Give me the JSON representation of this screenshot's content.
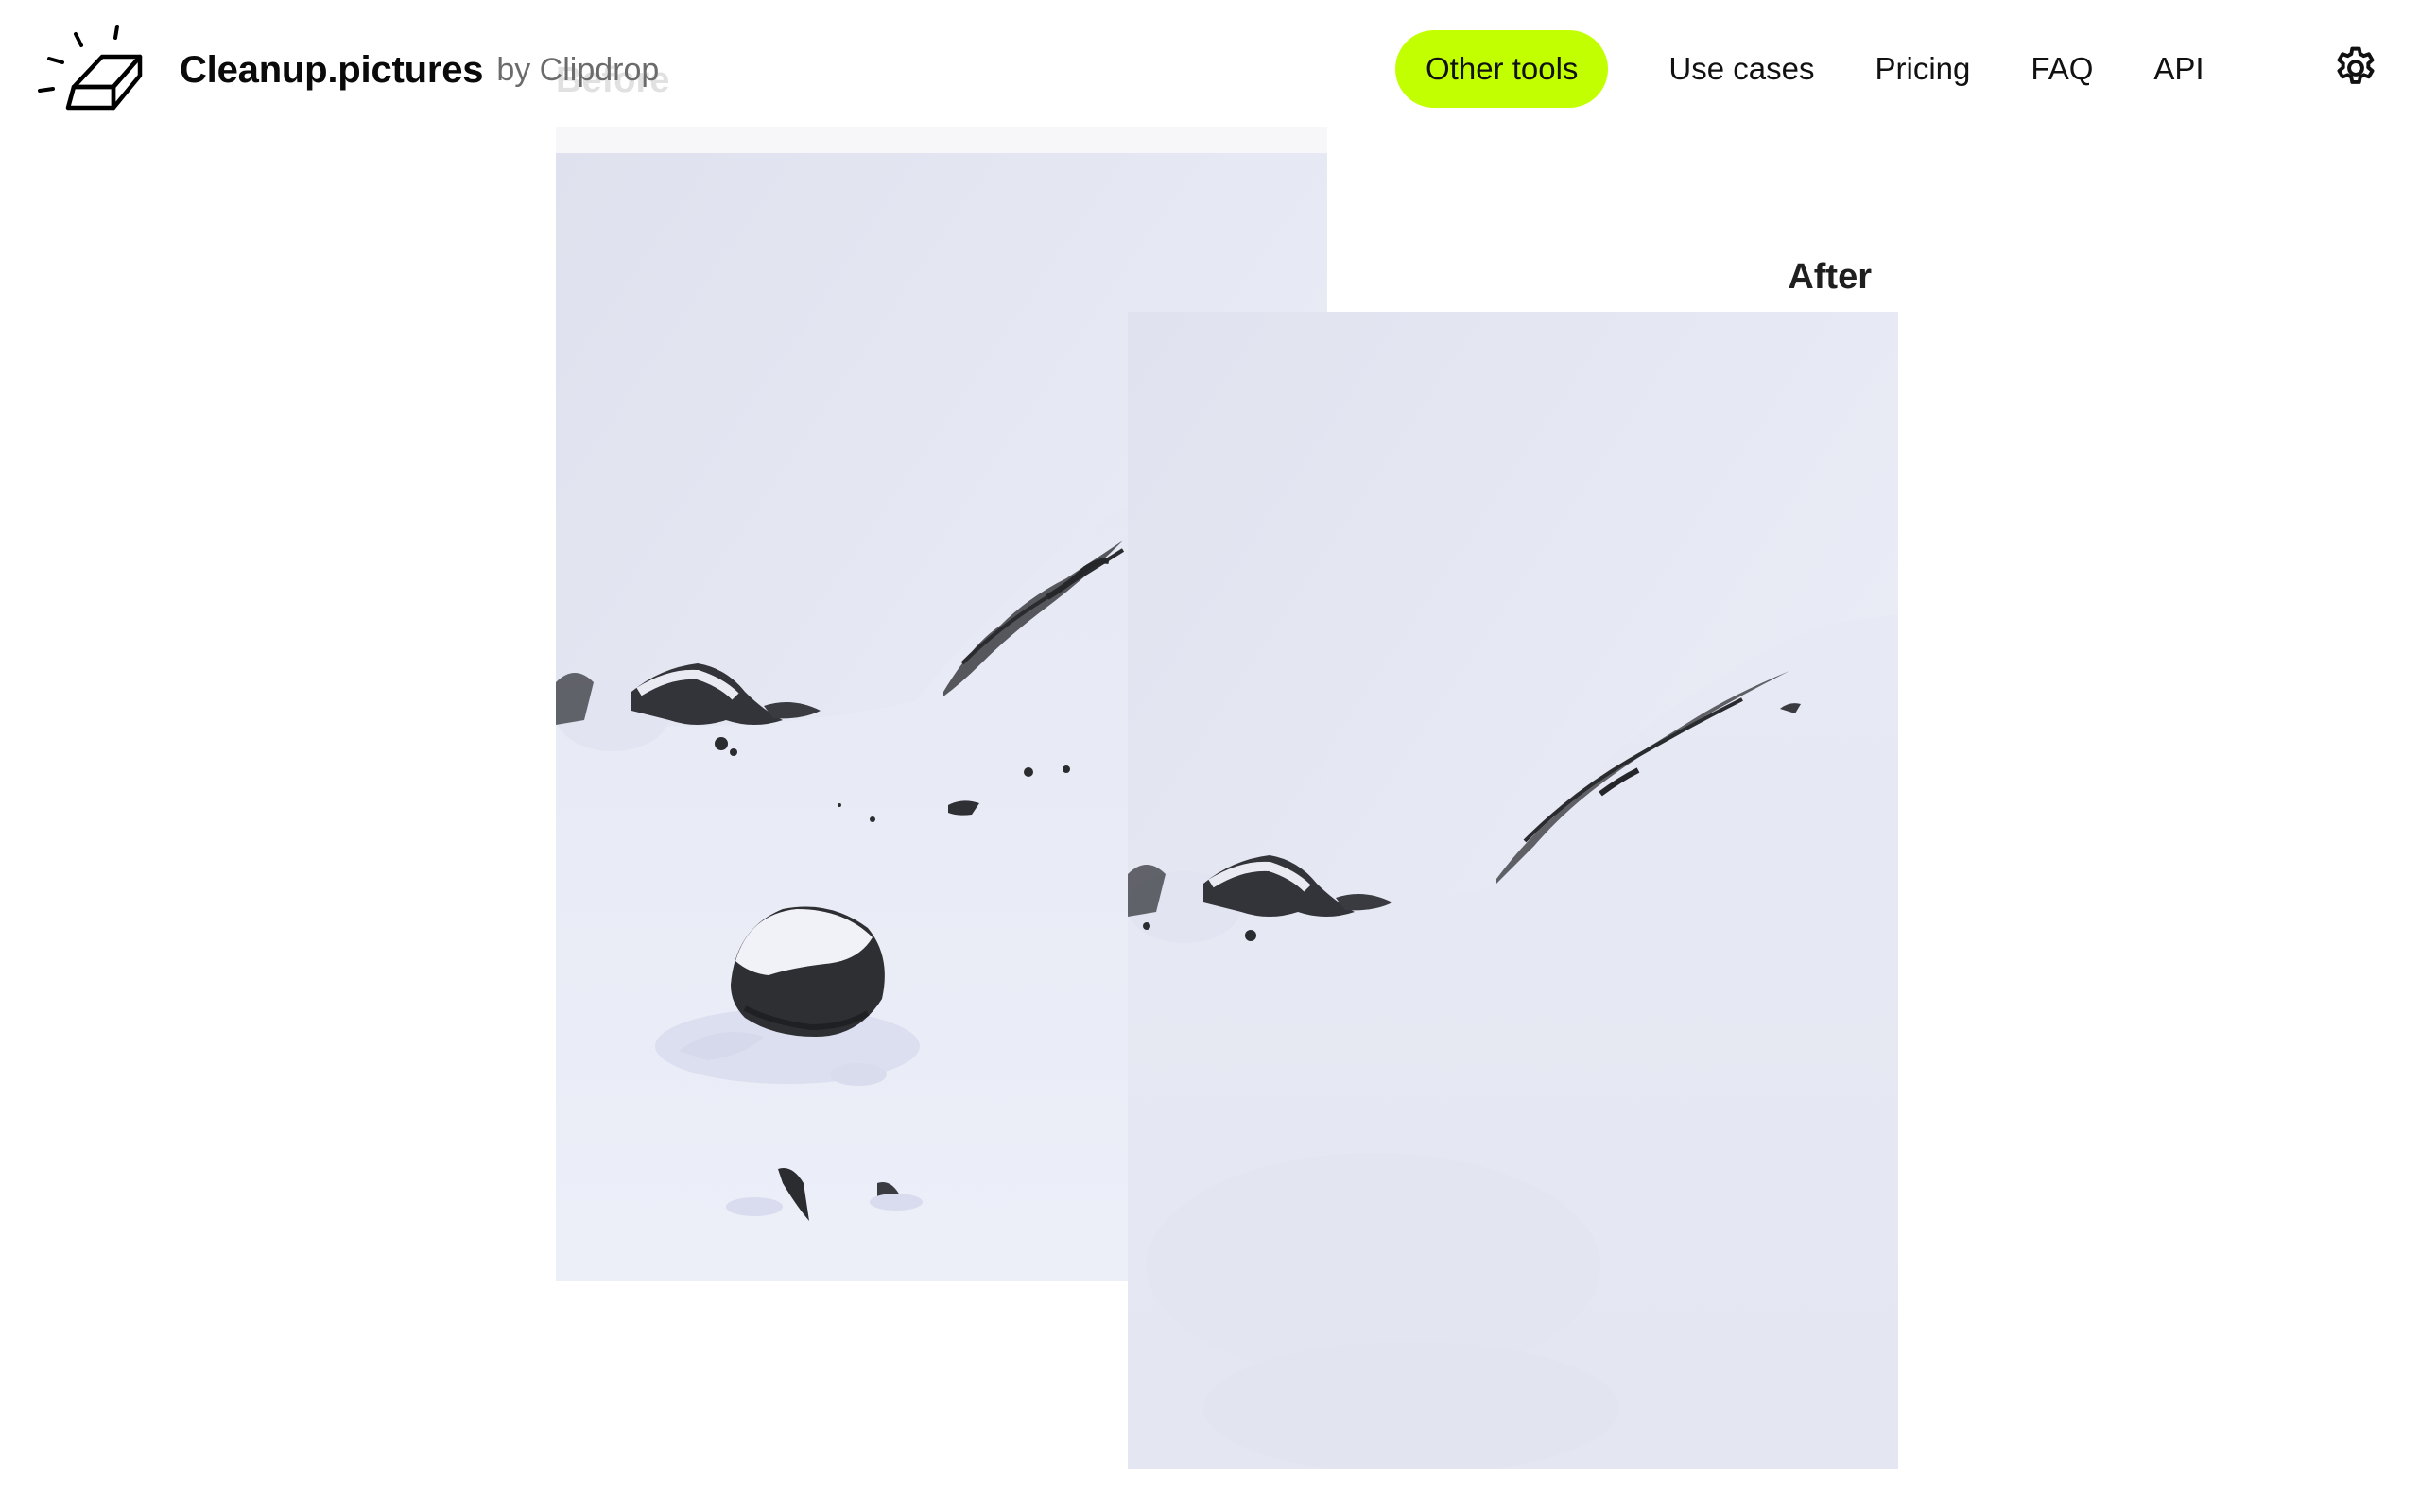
{
  "header": {
    "brand_name": "Cleanup.pictures",
    "brand_by": "by Clipdrop",
    "logo_icon": "eraser-sparkle-icon"
  },
  "nav": {
    "items": [
      {
        "label": "Other tools",
        "highlighted": true
      },
      {
        "label": "Use cases"
      },
      {
        "label": "Pricing"
      },
      {
        "label": "FAQ"
      },
      {
        "label": "API"
      }
    ],
    "settings_icon": "gear-icon"
  },
  "comparison": {
    "before_label": "Before",
    "after_label": "After"
  },
  "colors": {
    "accent": "#c2ff00",
    "text": "#111111",
    "muted": "#6b6b6b",
    "snow": "#e6e8f3",
    "rock": "#2f3033"
  }
}
